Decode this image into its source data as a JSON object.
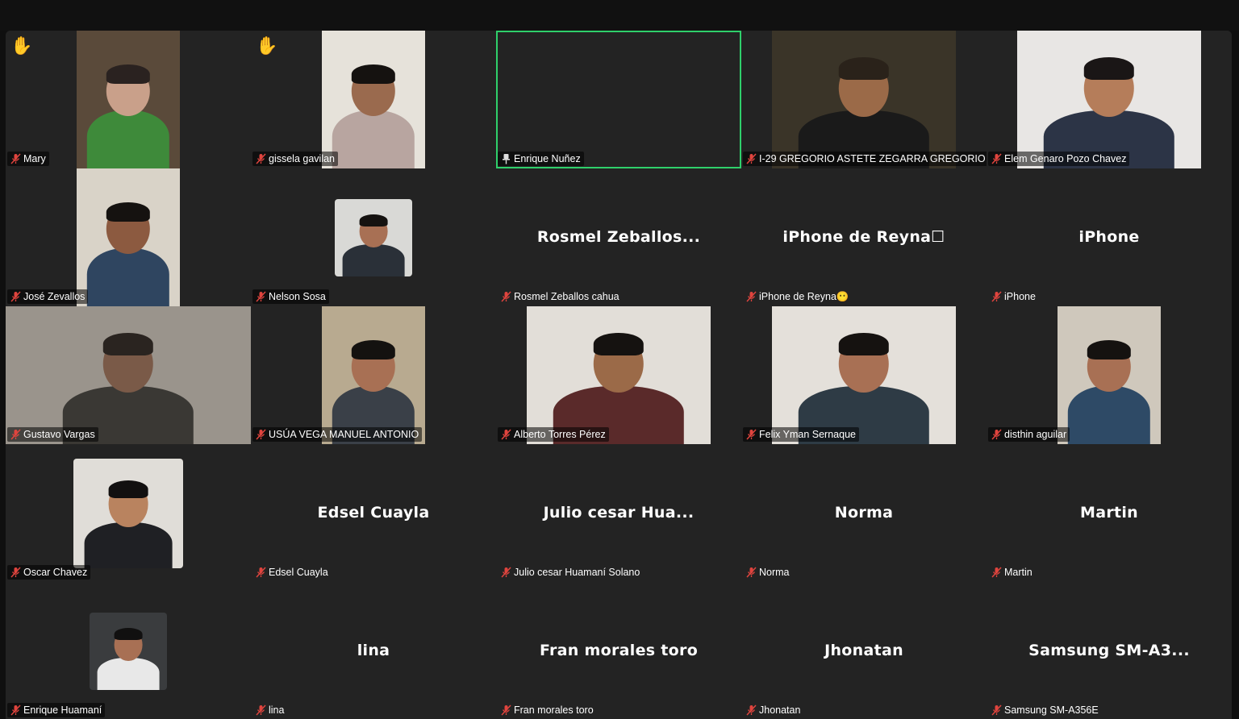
{
  "participants": [
    {
      "name": "Mary",
      "hand": "✋",
      "video": "person",
      "bg": "#5a4a3a",
      "shirt": "#3e8a3a",
      "skin": "#c9a08a",
      "hair": "#2a2220"
    },
    {
      "name": "gissela gavilan",
      "hand": "✋",
      "video": "person",
      "bg": "#e6e2da",
      "shirt": "#b8a5a0",
      "skin": "#9a6a4e",
      "hair": "#151210"
    },
    {
      "name": "Enrique Nuñez",
      "active": true,
      "pinned": true,
      "video": "person",
      "bg": "#eeece6",
      "shirt": "#2b2b2e",
      "skin": "#b9835f",
      "hair": "#141210"
    },
    {
      "name": "I-29 GREGORIO ASTETE ZEGARRA GREGORIO ...",
      "video": "person",
      "bg": "#3a3428",
      "shirt": "#1a1a1a",
      "skin": "#9b6a48",
      "hair": "#2a221a"
    },
    {
      "name": "Elem Genaro Pozo Chavez",
      "video": "person",
      "bg": "#e8e6e4",
      "shirt": "#2c3446",
      "skin": "#b57d5a",
      "hair": "#1a1616"
    },
    {
      "name": "José Zevallos",
      "video": "person",
      "bg": "#d9d3c8",
      "shirt": "#2f4560",
      "skin": "#8c5a40",
      "hair": "#151210"
    },
    {
      "name": "Nelson Sosa",
      "video": "square",
      "bg": "#d9d9d6",
      "shirt": "#2a3038",
      "skin": "#a87054",
      "hair": "#151210"
    },
    {
      "name": "Rosmel Zeballos cahua",
      "big": "Rosmel  Zeballos..."
    },
    {
      "name": "iPhone de Reyna😶",
      "big": "iPhone  de  Reyna☐"
    },
    {
      "name": "iPhone",
      "big": "iPhone"
    },
    {
      "name": "Gustavo Vargas",
      "video": "person",
      "bg": "#9a948c",
      "shirt": "#3a3834",
      "skin": "#7a5a48",
      "hair": "#2a2420"
    },
    {
      "name": "USÚA VEGA MANUEL ANTONIO",
      "video": "person",
      "bg": "#b8aa90",
      "shirt": "#3a4048",
      "skin": "#a87054",
      "hair": "#141210"
    },
    {
      "name": "Alberto Torres Pérez",
      "video": "person",
      "bg": "#e2ded8",
      "shirt": "#5a2a2a",
      "skin": "#9b6a48",
      "hair": "#151210"
    },
    {
      "name": "Felix Yman Sernaque",
      "video": "person",
      "bg": "#e4e0da",
      "shirt": "#2e3b45",
      "skin": "#a87054",
      "hair": "#151210"
    },
    {
      "name": "disthin aguilar",
      "video": "person",
      "bg": "#cfc8bc",
      "shirt": "#2e4a66",
      "skin": "#a87054",
      "hair": "#151210"
    },
    {
      "name": "Oscar Chavez",
      "video": "square",
      "bg": "#e0ddd8",
      "shirt": "#1f2024",
      "skin": "#b9835f",
      "hair": "#121010"
    },
    {
      "name": "Edsel Cuayla",
      "big": "Edsel Cuayla"
    },
    {
      "name": "Julio cesar Huamaní Solano",
      "big": "Julio  cesar  Hua..."
    },
    {
      "name": "Norma",
      "big": "Norma"
    },
    {
      "name": "Martin",
      "big": "Martin"
    },
    {
      "name": "Enrique Huamaní",
      "video": "square",
      "bg": "#3a3c3e",
      "shirt": "#e8e8e8",
      "skin": "#a87054",
      "hair": "#111010"
    },
    {
      "name": "lina",
      "big": "lina"
    },
    {
      "name": "Fran morales toro",
      "big": "Fran morales toro"
    },
    {
      "name": "Jhonatan",
      "big": "Jhonatan"
    },
    {
      "name": "Samsung SM-A356E",
      "big": "Samsung  SM-A3..."
    }
  ],
  "colors": {
    "active_border": "#2fd06b",
    "mic_muted": "#e0443e",
    "hand": "#f5c21b"
  }
}
